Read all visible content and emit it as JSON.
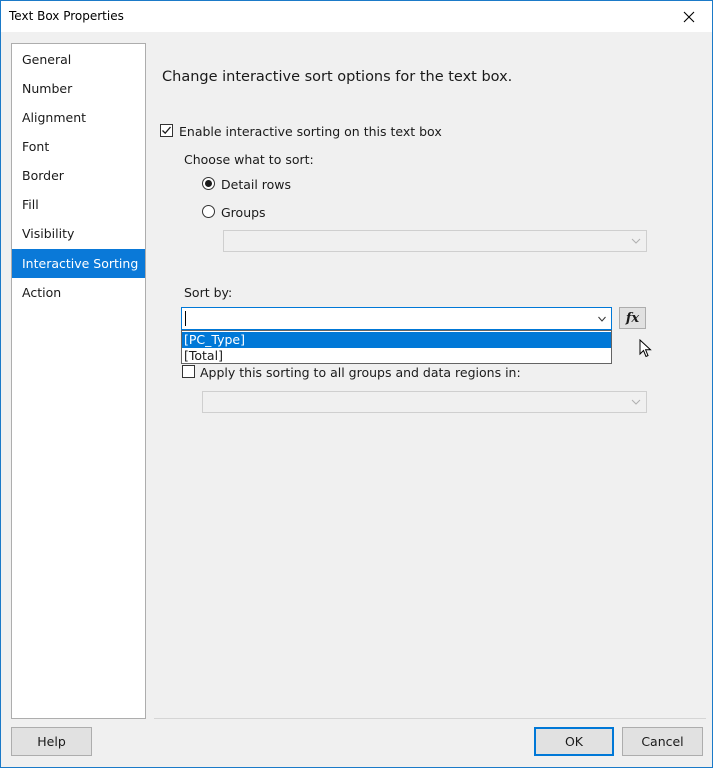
{
  "window": {
    "title": "Text Box Properties"
  },
  "nav": {
    "items": [
      {
        "label": "General"
      },
      {
        "label": "Number"
      },
      {
        "label": "Alignment"
      },
      {
        "label": "Font"
      },
      {
        "label": "Border"
      },
      {
        "label": "Fill"
      },
      {
        "label": "Visibility"
      },
      {
        "label": "Interactive Sorting",
        "selected": true
      },
      {
        "label": "Action"
      }
    ]
  },
  "content": {
    "heading": "Change interactive sort options for the text box.",
    "enable_checkbox": {
      "label": "Enable interactive sorting on this text box",
      "checked": true
    },
    "choose_label": "Choose what to sort:",
    "radio_detail": {
      "label": "Detail rows",
      "selected": true
    },
    "radio_groups": {
      "label": "Groups",
      "selected": false
    },
    "sort_by_label": "Sort by:",
    "sort_by_value": "",
    "fx_label": "fx",
    "dropdown_options": [
      "[PC_Type]",
      "[Total]"
    ],
    "apply_checkbox": {
      "label": "Apply this sorting to all groups and data regions in:",
      "checked": false
    }
  },
  "footer": {
    "help_label": "Help",
    "ok_label": "OK",
    "cancel_label": "Cancel"
  },
  "colors": {
    "accent": "#0078d7",
    "nav_selected": "#0a79d8",
    "window_border": "#1b7ac8"
  }
}
